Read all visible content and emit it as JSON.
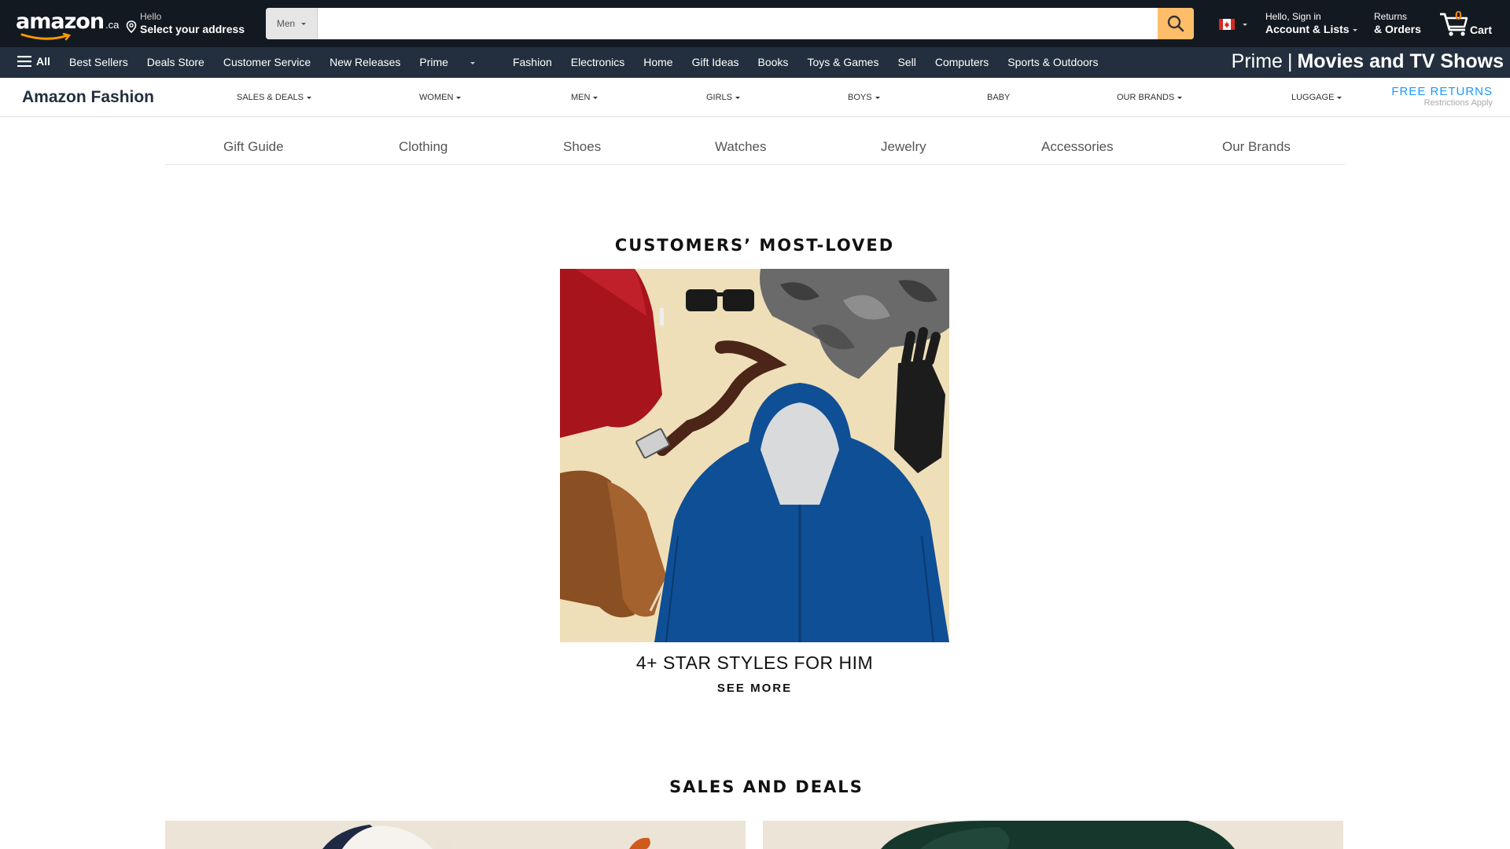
{
  "header": {
    "logo_word": "amazon",
    "logo_tld": ".ca",
    "deliver_line1": "Hello",
    "deliver_line2": "Select your address",
    "search_category": "Men",
    "search_value": "",
    "account_line1": "Hello, Sign in",
    "account_line2": "Account & Lists",
    "orders_line1": "Returns",
    "orders_line2": "& Orders",
    "cart_count": "0",
    "cart_label": "Cart"
  },
  "nav": {
    "all_label": "All",
    "links": [
      "Best Sellers",
      "Deals Store",
      "Customer Service",
      "New Releases",
      "Prime",
      "Fashion",
      "Electronics",
      "Home",
      "Gift Ideas",
      "Books",
      "Toys & Games",
      "Sell",
      "Computers",
      "Sports & Outdoors"
    ],
    "promo_prefix": "Prime",
    "promo_sep": "|",
    "promo_bold": "Movies and TV Shows"
  },
  "fashion_nav": {
    "brand": "Amazon Fashion",
    "items": [
      "SALES & DEALS",
      "WOMEN",
      "MEN",
      "GIRLS",
      "BOYS",
      "BABY",
      "OUR BRANDS",
      "LUGGAGE"
    ],
    "free_returns": "FREE RETURNS",
    "restrictions": "Restrictions Apply"
  },
  "categories": [
    "Gift Guide",
    "Clothing",
    "Shoes",
    "Watches",
    "Jewelry",
    "Accessories",
    "Our Brands"
  ],
  "sections": {
    "most_loved_title": "CUSTOMERS’ MOST-LOVED",
    "hero_caption": "4+ STAR STYLES FOR HIM",
    "see_more": "SEE MORE",
    "sales_title": "SALES AND DEALS"
  },
  "colors": {
    "nav_dark": "#131921",
    "nav_secondary": "#232f3e",
    "search_button": "#febd69",
    "cart_count": "#f08804",
    "free_returns": "#1a98ff"
  }
}
